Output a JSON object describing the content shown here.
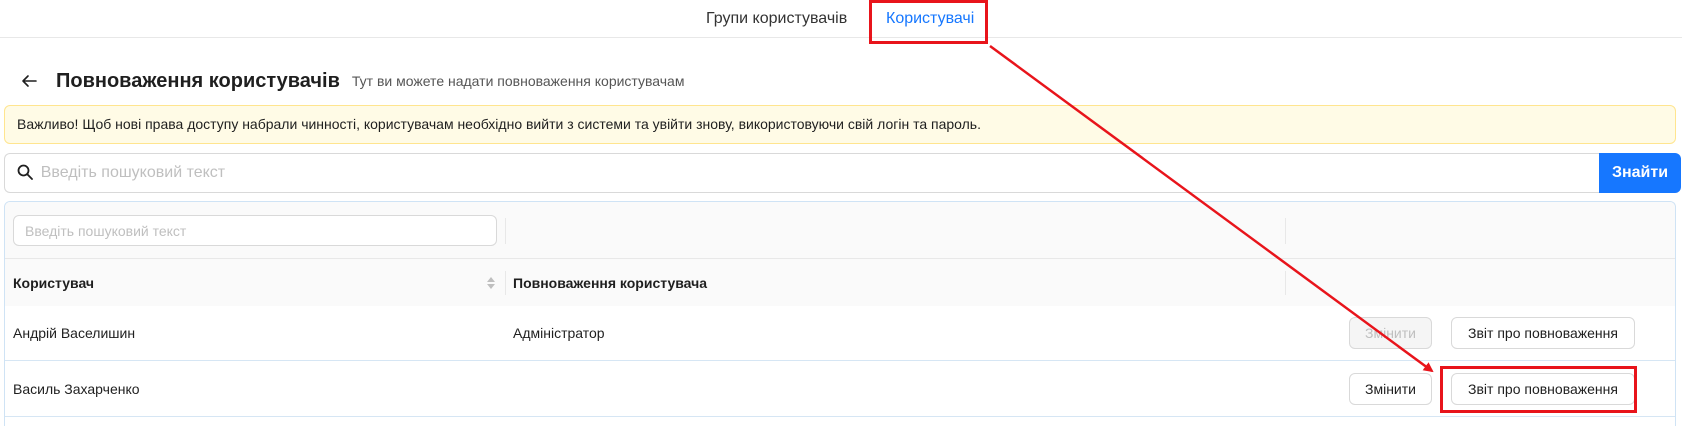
{
  "tabs": [
    {
      "label": "Групи користувачів",
      "active": false
    },
    {
      "label": "Користувачі",
      "active": true
    }
  ],
  "header": {
    "title": "Повноваження користувачів",
    "subtitle": "Тут ви можете надати повноваження користувачам"
  },
  "alert": {
    "text": "Важливо! Щоб нові права доступу набрали чинності, користувачам необхідно вийти з системи та увійти знову, використовуючи свій логін та пароль."
  },
  "search": {
    "placeholder": "Введіть пошуковий текст",
    "button_label": "Знайти"
  },
  "table": {
    "filter_placeholder": "Введіть пошуковий текст",
    "columns": [
      "Користувач",
      "Повноваження користувача"
    ],
    "rows": [
      {
        "user": "Андрій Васелишин",
        "permission": "Адміністратор",
        "edit_label": "Змінити",
        "edit_disabled": true,
        "report_label": "Звіт про повноваження"
      },
      {
        "user": "Василь Захарченко",
        "permission": "",
        "edit_label": "Змінити",
        "edit_disabled": false,
        "report_label": "Звіт про повноваження"
      }
    ]
  },
  "colors": {
    "accent": "#1677ff",
    "annotation": "#e8141b",
    "alert_bg": "#fffbe6"
  },
  "icons": [
    "back-arrow-icon",
    "search-icon",
    "sort-icon"
  ]
}
